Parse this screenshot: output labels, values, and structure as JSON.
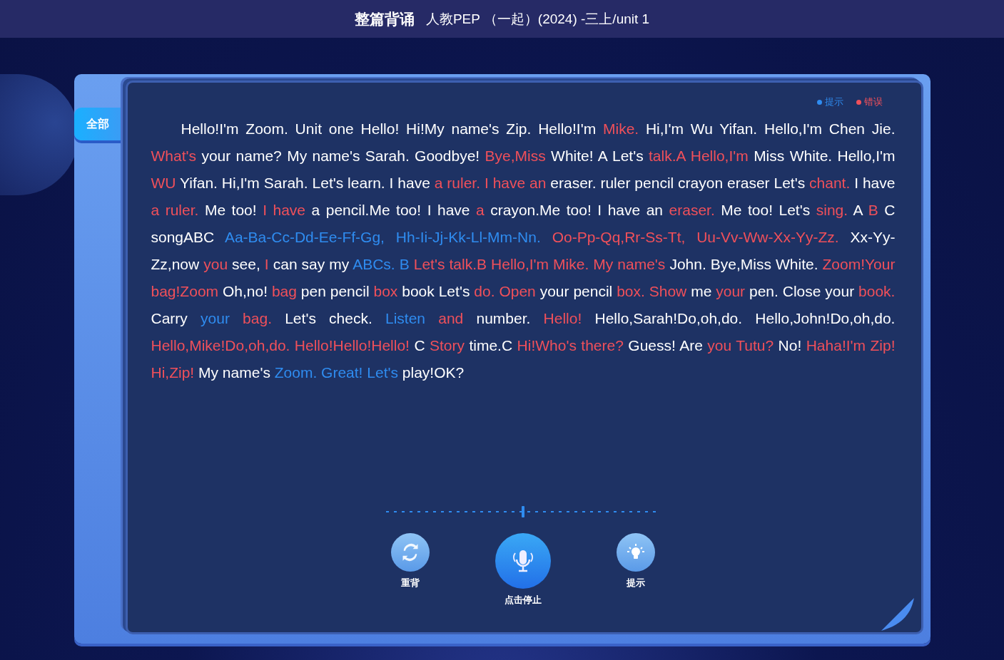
{
  "header": {
    "title": "整篇背诵",
    "subtitle": "人教PEP （一起）(2024) -三上/unit 1"
  },
  "tabs": [
    {
      "label": "全部",
      "selected": true
    }
  ],
  "legend": [
    {
      "label": "提示",
      "color": "#2f8cf0"
    },
    {
      "label": "错误",
      "color": "#f0505a"
    }
  ],
  "passage": [
    {
      "kind": "plain",
      "text": "Hello!I'm Zoom. Unit one Hello! Hi!My name's Zip. Hello!I'm"
    },
    {
      "kind": "error",
      "text": "Mike."
    },
    {
      "kind": "plain",
      "text": "Hi,I'm Wu Yifan. Hello,I'm Chen Jie."
    },
    {
      "kind": "error",
      "text": "What's"
    },
    {
      "kind": "plain",
      "text": "your name? My name's Sarah. Goodbye!"
    },
    {
      "kind": "error",
      "text": "Bye,Miss"
    },
    {
      "kind": "plain",
      "text": "White! A Let's"
    },
    {
      "kind": "error",
      "text": "talk.A Hello,I'm"
    },
    {
      "kind": "plain",
      "text": "Miss White. Hello,I'm"
    },
    {
      "kind": "error",
      "text": "WU"
    },
    {
      "kind": "plain",
      "text": "Yifan. Hi,I'm Sarah. Let's learn. I have"
    },
    {
      "kind": "error",
      "text": "a ruler. I have an"
    },
    {
      "kind": "plain",
      "text": "eraser. ruler pencil crayon eraser Let's"
    },
    {
      "kind": "error",
      "text": "chant."
    },
    {
      "kind": "plain",
      "text": "I have"
    },
    {
      "kind": "error",
      "text": "a ruler."
    },
    {
      "kind": "plain",
      "text": "Me too!"
    },
    {
      "kind": "error",
      "text": "I have"
    },
    {
      "kind": "plain",
      "text": "a pencil.Me too! I have"
    },
    {
      "kind": "error",
      "text": "a"
    },
    {
      "kind": "plain",
      "text": "crayon.Me too! I have an"
    },
    {
      "kind": "error",
      "text": "eraser."
    },
    {
      "kind": "plain",
      "text": "Me too! Let's"
    },
    {
      "kind": "error",
      "text": "sing."
    },
    {
      "kind": "plain",
      "text": "A"
    },
    {
      "kind": "error",
      "text": "B"
    },
    {
      "kind": "plain",
      "text": "C songABC"
    },
    {
      "kind": "hint",
      "text": "Aa-Ba-Cc-Dd-Ee-Ff-Gg, Hh-Ii-Jj-Kk-Ll-Mm-Nn."
    },
    {
      "kind": "error",
      "text": "Oo-Pp-Qq,Rr-Ss-Tt, Uu-Vv-Ww-Xx-Yy-Zz."
    },
    {
      "kind": "plain",
      "text": "Xx-Yy-Zz,now"
    },
    {
      "kind": "error",
      "text": "you"
    },
    {
      "kind": "plain",
      "text": "see,"
    },
    {
      "kind": "error",
      "text": "I"
    },
    {
      "kind": "plain",
      "text": "can say my"
    },
    {
      "kind": "hint",
      "text": "ABCs. B"
    },
    {
      "kind": "error",
      "text": "Let's talk.B Hello,I'm Mike. My name's"
    },
    {
      "kind": "plain",
      "text": "John. Bye,Miss White."
    },
    {
      "kind": "error",
      "text": "Zoom!Your bag!Zoom"
    },
    {
      "kind": "plain",
      "text": "Oh,no!"
    },
    {
      "kind": "error",
      "text": "bag"
    },
    {
      "kind": "plain",
      "text": "pen pencil"
    },
    {
      "kind": "error",
      "text": "box"
    },
    {
      "kind": "plain",
      "text": "book Let's"
    },
    {
      "kind": "error",
      "text": "do. Open"
    },
    {
      "kind": "plain",
      "text": "your pencil"
    },
    {
      "kind": "error",
      "text": "box. Show"
    },
    {
      "kind": "plain",
      "text": "me"
    },
    {
      "kind": "error",
      "text": "your"
    },
    {
      "kind": "plain",
      "text": "pen. Close your"
    },
    {
      "kind": "error",
      "text": "book."
    },
    {
      "kind": "plain",
      "text": "Carry"
    },
    {
      "kind": "hint",
      "text": "your"
    },
    {
      "kind": "error",
      "text": "bag."
    },
    {
      "kind": "plain",
      "text": "Let's check."
    },
    {
      "kind": "hint",
      "text": "Listen"
    },
    {
      "kind": "error",
      "text": "and"
    },
    {
      "kind": "plain",
      "text": "number."
    },
    {
      "kind": "error",
      "text": "Hello!"
    },
    {
      "kind": "plain",
      "text": "Hello,Sarah!Do,oh,do. Hello,John!Do,oh,do."
    },
    {
      "kind": "error",
      "text": "Hello,Mike!Do,oh,do. Hello!Hello!Hello!"
    },
    {
      "kind": "plain",
      "text": "C"
    },
    {
      "kind": "error",
      "text": "Story"
    },
    {
      "kind": "plain",
      "text": "time.C"
    },
    {
      "kind": "error",
      "text": "Hi!Who's there?"
    },
    {
      "kind": "plain",
      "text": "Guess! Are"
    },
    {
      "kind": "error",
      "text": "you Tutu?"
    },
    {
      "kind": "plain",
      "text": "No!"
    },
    {
      "kind": "error",
      "text": "Haha!I'm Zip! Hi,Zip!"
    },
    {
      "kind": "plain",
      "text": "My name's"
    },
    {
      "kind": "hint",
      "text": "Zoom. Great! Let's"
    },
    {
      "kind": "plain",
      "text": "play!OK?"
    }
  ],
  "progress": {
    "level": 0.5
  },
  "controls": [
    {
      "kind": "restart",
      "label": "重背"
    },
    {
      "kind": "record",
      "label": "点击停止"
    },
    {
      "kind": "hint",
      "label": "提示"
    }
  ]
}
